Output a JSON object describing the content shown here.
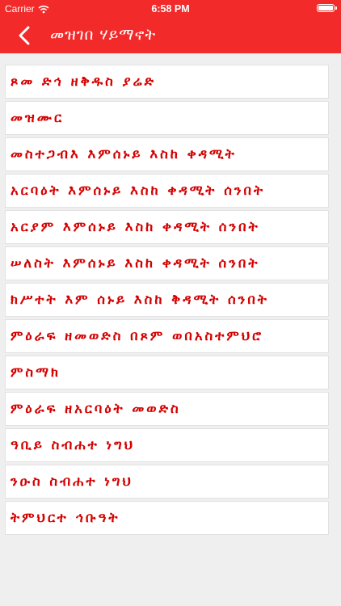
{
  "status_bar": {
    "carrier": "Carrier",
    "time": "6:58 PM"
  },
  "nav": {
    "title": "መዝገበ ሃይማኖት"
  },
  "items": [
    {
      "label": "ጾመ ድኅ ዘቅዱስ ያሬድ"
    },
    {
      "label": "መዝሙር"
    },
    {
      "label": "መስተጋብእ እምሰኑይ እስከ ቀዳሚት"
    },
    {
      "label": "አርባዕት እምሰኑይ እስከ ቀዳሚት ሰንበት"
    },
    {
      "label": "አርያም እምሰኑይ እስከ ቀዳሚት ሰንበት"
    },
    {
      "label": "ሠለስት እምሰኑይ እስከ ቀዳሚት ሰንበት"
    },
    {
      "label": "ክሥተት እም ሰኑይ እስከ ቅዳሚት ሰንበት"
    },
    {
      "label": "ምዕራፍ ዘመወድስ በጾም ወበአስተምህሮ"
    },
    {
      "label": "ምስማክ"
    },
    {
      "label": "ምዕራፍ ዘአርባዕት መወድስ"
    },
    {
      "label": "ዓቢይ ስብሐተ ነግህ"
    },
    {
      "label": "ንዑስ ስብሐተ ነግህ"
    },
    {
      "label": "ትምህርተ ኅቡዓት"
    }
  ],
  "colors": {
    "accent": "#f22a2a",
    "item_text": "#d40000",
    "background": "#efefef"
  }
}
